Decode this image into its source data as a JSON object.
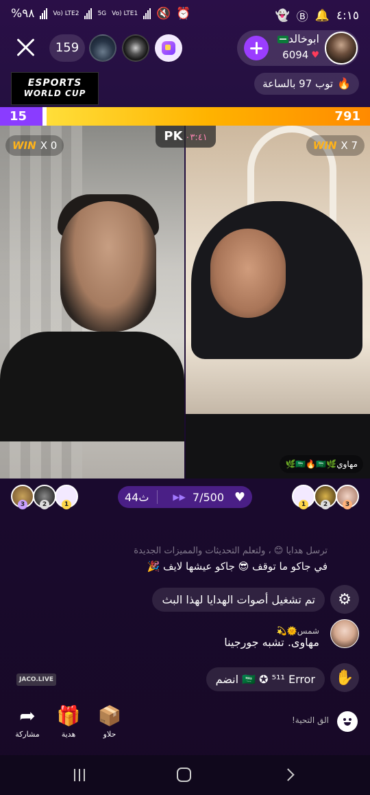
{
  "status_bar": {
    "battery": "%٩٨",
    "network1": "Vo) LTE2",
    "network2": "5G",
    "network3": "Vo) LTE1",
    "time": "٤:١٥"
  },
  "top_bar": {
    "viewer_count": "159",
    "host": {
      "name": "ابوخالد",
      "score": "6094"
    }
  },
  "badges": {
    "event_logo_line1": "ESPORTS",
    "event_logo_line2": "WORLD CUP",
    "hourly_rank": "توب 97 بالساعة"
  },
  "pk": {
    "left_score": "15",
    "right_score": "791",
    "left_score_share": 0.12,
    "label": "PK",
    "timer": "٠٣:٤١",
    "left_win_label": "WIN",
    "left_win_count": "X 0",
    "right_win_label": "WIN",
    "right_win_count": "X 7",
    "guest_name": "مهاوي🌿🇸🇦🔥🇸🇦🌿"
  },
  "goal": {
    "coins": "44ث",
    "progress": "7/500"
  },
  "contributors": {
    "left_ranks": [
      "3",
      "2",
      "1"
    ],
    "right_ranks": [
      "1",
      "2",
      "3"
    ]
  },
  "chat": {
    "system_faded": "ترسل هدايا 😊 ، ولتعلم التحديثات والمميزات الجديدة",
    "system_msg": "في جاكو ما توقف 😎 جاكو عيشها لايف 🎉",
    "gift_sound_msg": "تم تشغيل أصوات الهدايا لهذا البث",
    "user_name": "شمس🌞💫",
    "user_msg": "مهاوى. تشبه جورجينا",
    "join_msg": "🇸🇦 ✪ ⁵¹¹ Error انضم",
    "jaco_badge": "JACO.LIVE"
  },
  "actions": {
    "share": "مشاركة",
    "gift": "هدية",
    "sweets": "حلاو",
    "greeting": "الق التحية!"
  },
  "colors": {
    "accent_purple": "#9b3dff",
    "pk_orange": "#ff8a00",
    "win_gold": "#ffb319"
  }
}
